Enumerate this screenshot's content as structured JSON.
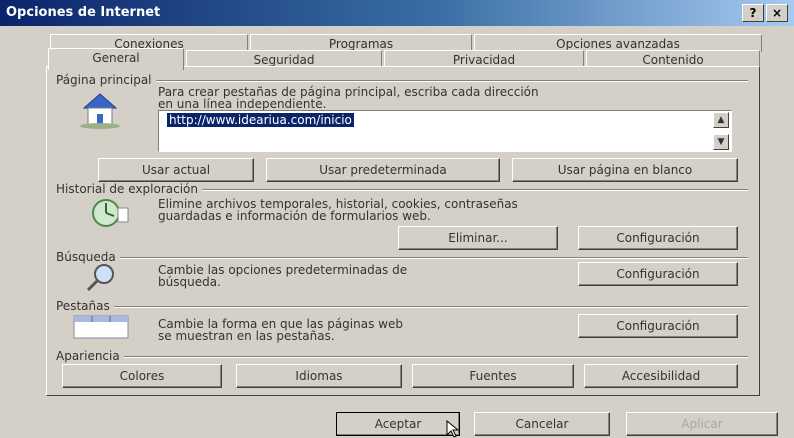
{
  "window": {
    "title": "Opciones de Internet",
    "help": "?",
    "close": "×"
  },
  "tabs_back": [
    "Conexiones",
    "Programas",
    "Opciones avanzadas"
  ],
  "tabs_front": [
    "General",
    "Seguridad",
    "Privacidad",
    "Contenido"
  ],
  "home": {
    "label": "Página principal",
    "desc1": "Para crear pestañas de página principal, escriba cada dirección",
    "desc2": "en una línea independiente.",
    "url": "http://www.ideariua.com/inicio",
    "btn_actual": "Usar actual",
    "btn_default": "Usar predeterminada",
    "btn_blank": "Usar página en blanco"
  },
  "history": {
    "label": "Historial de exploración",
    "desc1": "Elimine archivos temporales, historial, cookies, contraseñas",
    "desc2": "guardadas e información de formularios web.",
    "btn_delete": "Eliminar...",
    "btn_config": "Configuración"
  },
  "search": {
    "label": "Búsqueda",
    "desc1": "Cambie las opciones predeterminadas de",
    "desc2": "búsqueda.",
    "btn_config": "Configuración"
  },
  "tabsgrp": {
    "label": "Pestañas",
    "desc1": "Cambie la forma en que las páginas web",
    "desc2": "se muestran en las pestañas.",
    "btn_config": "Configuración"
  },
  "appearance": {
    "label": "Apariencia",
    "btn_colors": "Colores",
    "btn_lang": "Idiomas",
    "btn_fonts": "Fuentes",
    "btn_access": "Accesibilidad"
  },
  "footer": {
    "ok": "Aceptar",
    "cancel": "Cancelar",
    "apply": "Aplicar"
  }
}
